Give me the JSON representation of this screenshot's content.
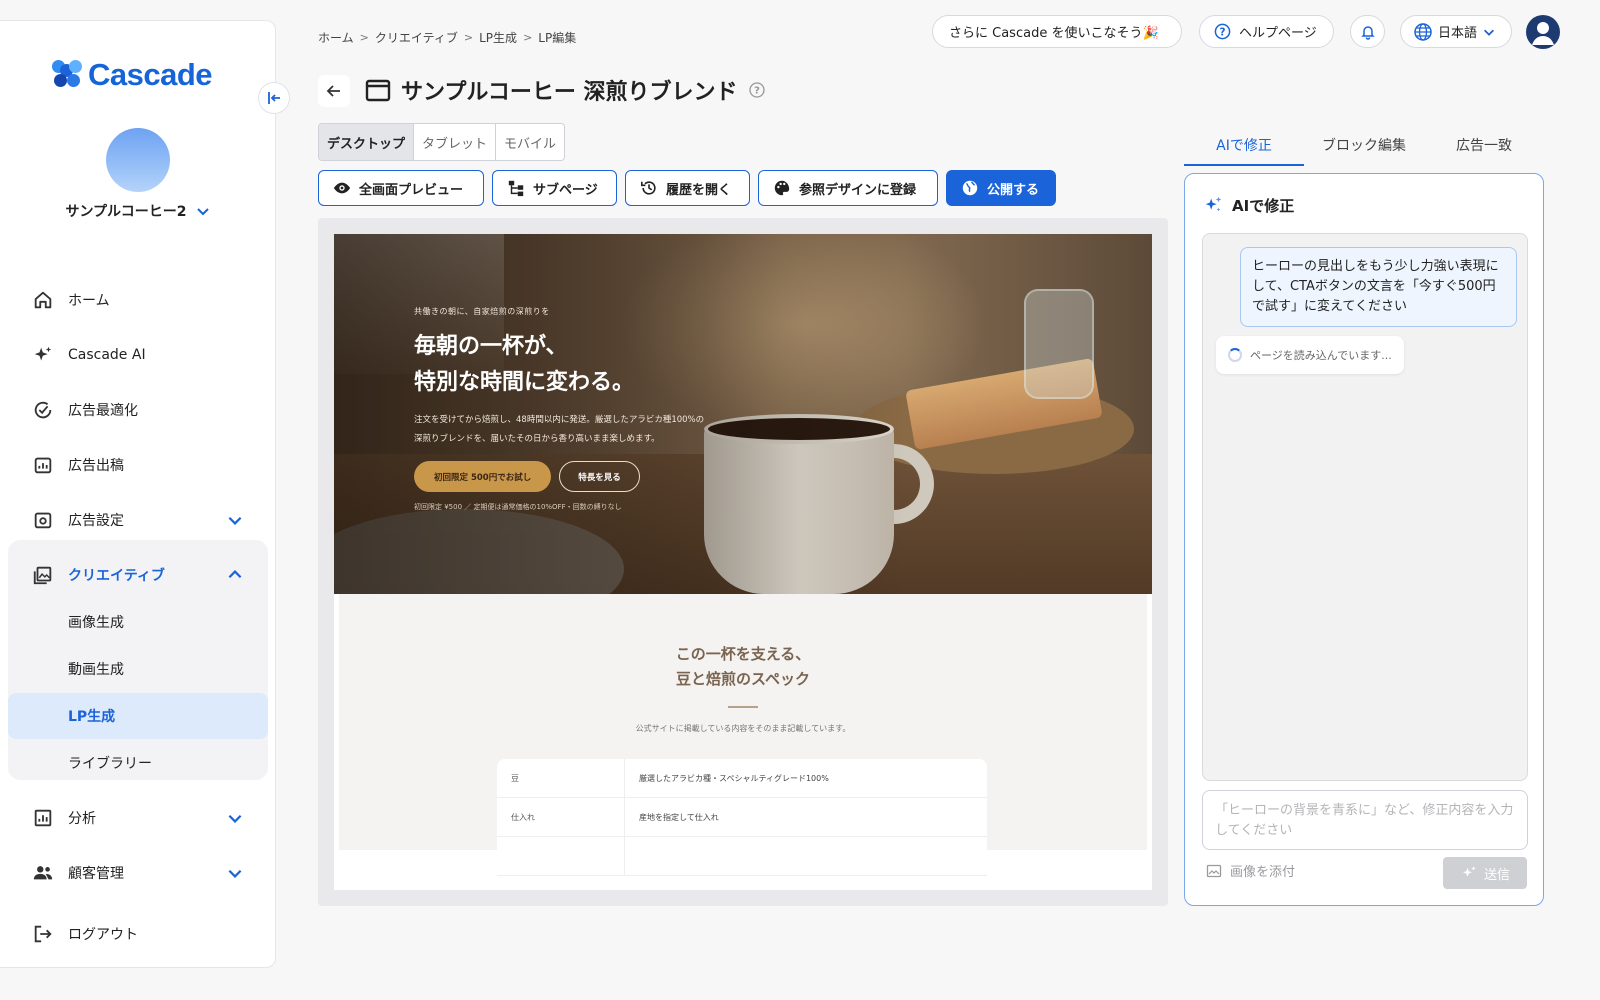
{
  "brand": {
    "name": "Cascade",
    "accent": "#1a63d8"
  },
  "sidebar": {
    "account": "サンプルコーヒー2",
    "items": [
      {
        "label": "ホーム",
        "icon": "home-icon"
      },
      {
        "label": "Cascade AI",
        "icon": "sparkle-icon"
      },
      {
        "label": "広告最適化",
        "icon": "optimize-icon"
      },
      {
        "label": "広告出稿",
        "icon": "ad-publish-icon"
      },
      {
        "label": "広告設定",
        "icon": "ad-settings-icon"
      },
      {
        "label": "クリエイティブ",
        "icon": "image-gallery-icon"
      },
      {
        "label": "分析",
        "icon": "analytics-icon"
      },
      {
        "label": "顧客管理",
        "icon": "customers-icon"
      },
      {
        "label": "ログアウト",
        "icon": "logout-icon"
      }
    ],
    "creative_sub": [
      "画像生成",
      "動画生成",
      "LP生成",
      "ライブラリー"
    ]
  },
  "breadcrumb": [
    "ホーム",
    "クリエイティブ",
    "LP生成",
    "LP編集"
  ],
  "topbar": {
    "promo": "さらに Cascade を使いこなそう🎉",
    "help": "ヘルプページ",
    "language": "日本語"
  },
  "page": {
    "title": "サンプルコーヒー 深煎りブレンド"
  },
  "devices": {
    "desktop": "デスクトップ",
    "tablet": "タブレット",
    "mobile": "モバイル",
    "selected": "デスクトップ"
  },
  "actions": {
    "preview": "全画面プレビュー",
    "subpage": "サブページ",
    "history": "履歴を開く",
    "register": "参照デザインに登録",
    "publish": "公開する"
  },
  "lp": {
    "eyebrow": "共働きの朝に、自家焙煎の深煎りを",
    "headline1": "毎朝の一杯が、",
    "headline2": "特別な時間に変わる。",
    "lead1": "注文を受けてから焙煎し、48時間以内に発送。厳選したアラビカ種100%の",
    "lead2": "深煎りブレンドを、届いたその日から香り高いまま楽しめます。",
    "cta_primary": "初回限定 500円でお試し",
    "cta_secondary": "特長を見る",
    "note": "初回限定 ¥500 ／ 定期便は通常価格の10%OFF・回数の縛りなし",
    "spec_title1": "この一杯を支える、",
    "spec_title2": "豆と焙煎のスペック",
    "spec_sub": "公式サイトに掲載している内容をそのまま記載しています。",
    "spec_rows": [
      {
        "k": "豆",
        "v": "厳選したアラビカ種・スペシャルティグレード100%"
      },
      {
        "k": "仕入れ",
        "v": "産地を指定して仕入れ"
      }
    ]
  },
  "right": {
    "tabs": [
      "AIで修正",
      "ブロック編集",
      "広告一致"
    ],
    "panel_title": "AIで修正",
    "user_message": "ヒーローの見出しをもう少し力強い表現にして、CTAボタンの文言を「今すぐ500円で試す」に変えてください",
    "ai_status": "ページを読み込んでいます...",
    "input_placeholder": "「ヒーローの背景を青系に」など、修正内容を入力してください",
    "attach": "画像を添付",
    "send": "送信"
  }
}
